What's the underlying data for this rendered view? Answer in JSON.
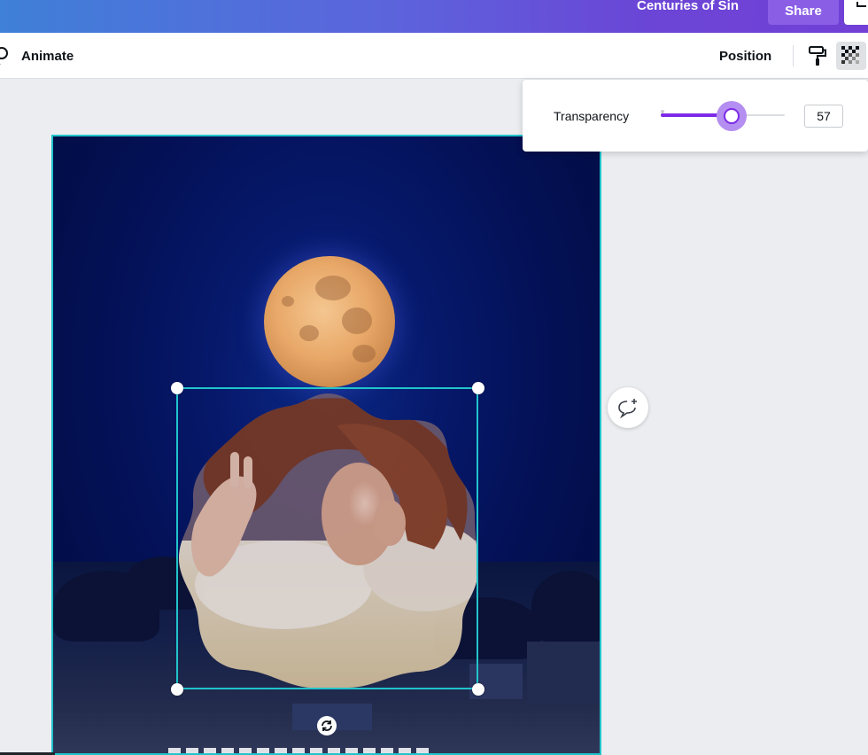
{
  "header": {
    "doc_title": "Centuries of Sin",
    "share_label": "Share",
    "download_icon": "download-icon",
    "gradient_colors": [
      "#3f80d8",
      "#7240d6"
    ]
  },
  "toolbar": {
    "animate_label": "Animate",
    "animate_icon": "animate-icon",
    "position_label": "Position",
    "copy_style_icon": "paint-roller-icon",
    "transparency_icon": "transparency-checker-icon"
  },
  "transparency_popover": {
    "label": "Transparency",
    "value": 57,
    "value_text": "57",
    "min": 0,
    "max": 100,
    "accent_color": "#7d2ae8"
  },
  "canvas": {
    "selection_color": "#20c4cb",
    "comment_icon": "add-comment-icon",
    "rotate_icon": "rotate-icon"
  }
}
